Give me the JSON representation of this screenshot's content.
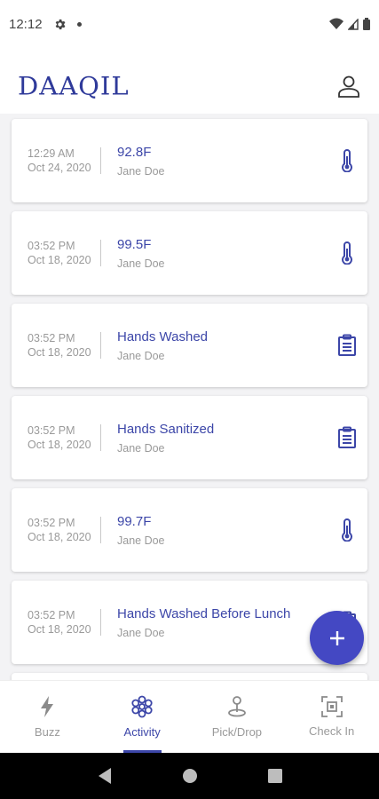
{
  "status_bar": {
    "time": "12:12"
  },
  "app": {
    "logo": "DAAQIL"
  },
  "entries": [
    {
      "time": "12:29 AM",
      "date": "Oct 24, 2020",
      "title": "92.8F",
      "person": "Jane Doe",
      "icon": "thermometer-icon"
    },
    {
      "time": "03:52 PM",
      "date": "Oct 18, 2020",
      "title": "99.5F",
      "person": "Jane Doe",
      "icon": "thermometer-icon"
    },
    {
      "time": "03:52 PM",
      "date": "Oct 18, 2020",
      "title": "Hands Washed",
      "person": "Jane Doe",
      "icon": "clipboard-icon"
    },
    {
      "time": "03:52 PM",
      "date": "Oct 18, 2020",
      "title": "Hands Sanitized",
      "person": "Jane Doe",
      "icon": "clipboard-icon"
    },
    {
      "time": "03:52 PM",
      "date": "Oct 18, 2020",
      "title": "99.7F",
      "person": "Jane Doe",
      "icon": "thermometer-icon"
    },
    {
      "time": "03:52 PM",
      "date": "Oct 18, 2020",
      "title": "Hands Washed Before Lunch",
      "person": "Jane Doe",
      "icon": "clipboard-icon"
    }
  ],
  "fab": {
    "icon": "plus-icon"
  },
  "bottom_nav": [
    {
      "label": "Buzz",
      "icon": "lightning-icon",
      "active": false
    },
    {
      "label": "Activity",
      "icon": "activity-icon",
      "active": true
    },
    {
      "label": "Pick/Drop",
      "icon": "location-pin-icon",
      "active": false
    },
    {
      "label": "Check In",
      "icon": "qr-scan-icon",
      "active": false
    }
  ],
  "colors": {
    "primary": "#3c46a8",
    "fab": "#4448c3",
    "muted_text": "#9a9a9a",
    "list_background": "#f3f3f5"
  }
}
